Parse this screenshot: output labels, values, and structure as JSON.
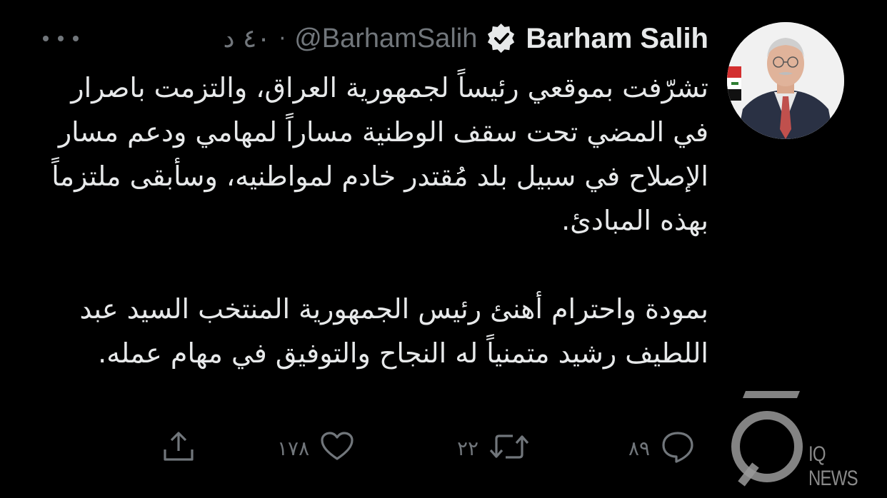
{
  "author": {
    "name": "Barham Salih",
    "handle": "@BarhamSalih",
    "separator": "·",
    "time": "٤٠ د",
    "verified_icon": "verified-badge-icon",
    "more_icon": "more-dots-icon"
  },
  "tweet": {
    "paragraph1": "تشرّفت بموقعي رئيساً لجمهورية العراق، والتزمت باصرار في المضي تحت سقف الوطنية مساراً لمهامي ودعم مسار الإصلاح في سبيل بلد مُقتدر خادم لمواطنيه، وسأبقى ملتزماً بهذه المبادئ.",
    "paragraph2": "بمودة واحترام أهنئ رئيس الجمهورية المنتخب السيد عبد اللطيف رشيد متمنياً له النجاح والتوفيق في مهام عمله."
  },
  "actions": {
    "reply": {
      "icon": "reply-icon",
      "count": "٨٩"
    },
    "retweet": {
      "icon": "retweet-icon",
      "count": "٢٢"
    },
    "like": {
      "icon": "heart-icon",
      "count": "١٧٨"
    },
    "share": {
      "icon": "share-icon"
    }
  },
  "watermark": {
    "text": "IQ NEWS"
  },
  "colors": {
    "background": "#000000",
    "text": "#e7e9ea",
    "muted": "#71767b"
  }
}
